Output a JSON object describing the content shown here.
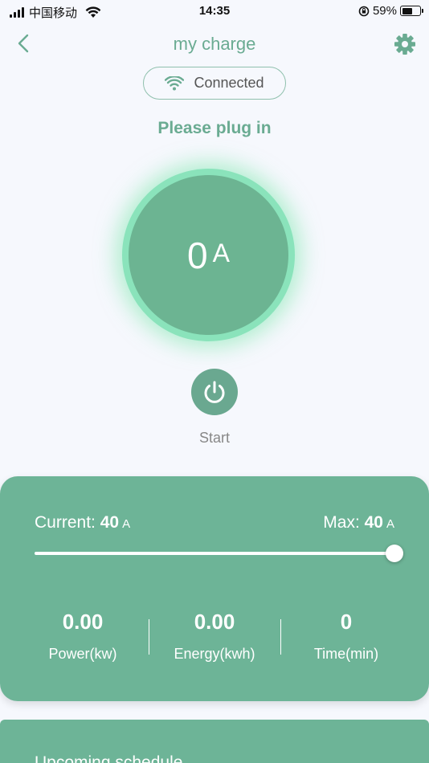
{
  "status_bar": {
    "carrier": "中国移动",
    "time": "14:35",
    "battery_text": "59%",
    "battery_level": 0.59
  },
  "header": {
    "title": "my charge"
  },
  "connection": {
    "label": "Connected"
  },
  "status_message": "Please plug in",
  "dial": {
    "value": "0",
    "unit": "A"
  },
  "start_label": "Start",
  "controls": {
    "current_label": "Current:",
    "current_value": "40",
    "current_unit": "A",
    "max_label": "Max:",
    "max_value": "40",
    "max_unit": "A",
    "slider_fraction": 1.0
  },
  "stats": [
    {
      "value": "0.00",
      "label": "Power(kw)"
    },
    {
      "value": "0.00",
      "label": "Energy(kwh)"
    },
    {
      "value": "0",
      "label": "Time(min)"
    }
  ],
  "schedule": {
    "title": "Upcoming schedule"
  },
  "colors": {
    "accent": "#6aab92",
    "card": "#6db497",
    "dial_glow": "#8ae3bb"
  }
}
